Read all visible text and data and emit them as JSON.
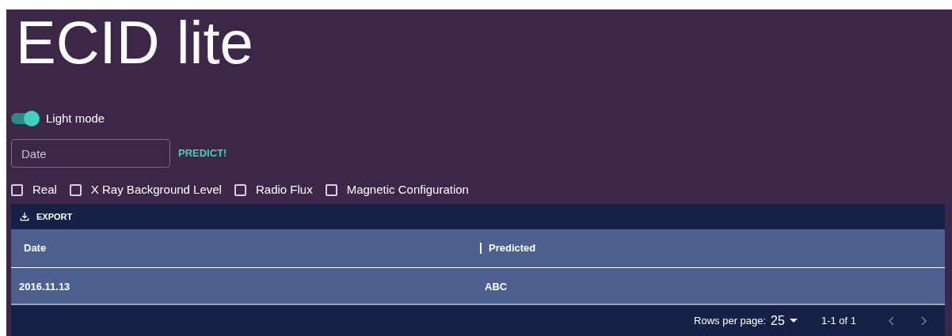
{
  "title": "ECID lite",
  "theme_switch": {
    "label": "Light mode",
    "on": true
  },
  "date_field": {
    "placeholder": "Date"
  },
  "predict_button": "PREDICT!",
  "options": [
    {
      "label": "Real",
      "checked": false
    },
    {
      "label": "X Ray Background Level",
      "checked": false
    },
    {
      "label": "Radio Flux",
      "checked": false
    },
    {
      "label": "Magnetic Configuration",
      "checked": false
    }
  ],
  "table": {
    "toolbar": {
      "export": "EXPORT"
    },
    "columns": [
      "Date",
      "Predicted"
    ],
    "rows": [
      [
        "2016.11.13",
        "ABC"
      ]
    ],
    "footer": {
      "rows_per_page_label": "Rows per page:",
      "rows_per_page": "25",
      "range": "1-1 of 1",
      "prev_disabled": true,
      "next_disabled": true
    }
  }
}
